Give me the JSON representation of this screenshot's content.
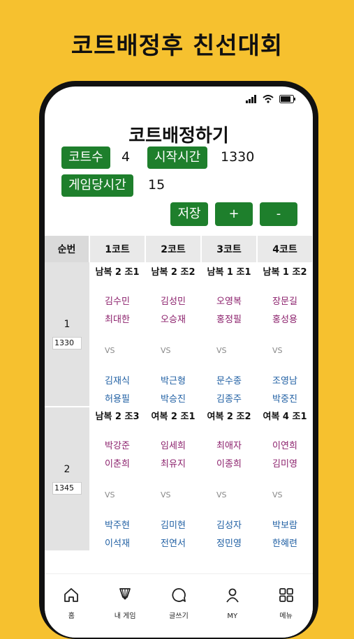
{
  "banner": {
    "title": "코트배정후 친선대회"
  },
  "screen": {
    "title": "코트배정하기",
    "court_count_label": "코트수",
    "court_count_value": "4",
    "start_time_label": "시작시간",
    "start_time_value": "1330",
    "per_game_label": "게임당시간",
    "per_game_value": "15",
    "buttons": {
      "save": "저장",
      "plus": "+",
      "minus": "-"
    }
  },
  "table": {
    "headers": [
      "순번",
      "1코트",
      "2코트",
      "3코트",
      "4코트"
    ],
    "vs": "VS",
    "rounds": [
      {
        "order": "1",
        "time": "1330",
        "courts": [
          {
            "game": "남복 2 조1",
            "team_a": [
              "김수민",
              "최대한"
            ],
            "team_b": [
              "김재식",
              "허용필"
            ]
          },
          {
            "game": "남복 2 조2",
            "team_a": [
              "김성민",
              "오승재"
            ],
            "team_b": [
              "박근형",
              "박승진"
            ]
          },
          {
            "game": "남복 1 조1",
            "team_a": [
              "오영복",
              "홍정필"
            ],
            "team_b": [
              "문수종",
              "김종주"
            ]
          },
          {
            "game": "남복 1 조2",
            "team_a": [
              "장문길",
              "홍성용"
            ],
            "team_b": [
              "조영남",
              "박중진"
            ]
          }
        ]
      },
      {
        "order": "2",
        "time": "1345",
        "courts": [
          {
            "game": "남복 2 조3",
            "team_a": [
              "박강준",
              "이춘희"
            ],
            "team_b": [
              "박주현",
              "이석재"
            ]
          },
          {
            "game": "여복 2 조1",
            "team_a": [
              "임세희",
              "최유지"
            ],
            "team_b": [
              "김미현",
              "전연서"
            ]
          },
          {
            "game": "여복 2 조2",
            "team_a": [
              "최애자",
              "이종희"
            ],
            "team_b": [
              "김성자",
              "정민영"
            ]
          },
          {
            "game": "여복 4 조1",
            "team_a": [
              "이연희",
              "김미영"
            ],
            "team_b": [
              "박보람",
              "한혜련"
            ]
          }
        ]
      }
    ]
  },
  "nav": [
    {
      "label": "홈",
      "icon": "home-icon"
    },
    {
      "label": "내 게임",
      "icon": "shuttlecock-icon"
    },
    {
      "label": "글쓰기",
      "icon": "chat-bubble-icon"
    },
    {
      "label": "MY",
      "icon": "person-icon"
    },
    {
      "label": "메뉴",
      "icon": "grid-menu-icon"
    }
  ]
}
